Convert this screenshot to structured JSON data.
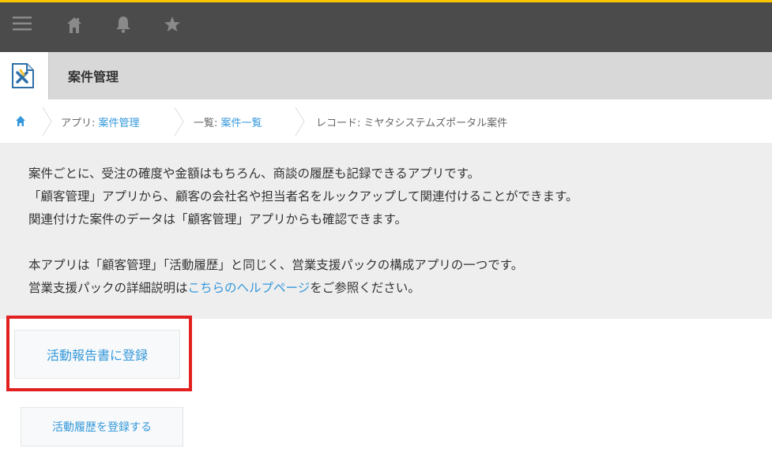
{
  "topbar": {
    "icons": [
      "menu-icon",
      "home-icon",
      "bell-icon",
      "star-icon"
    ]
  },
  "app_header": {
    "title": "案件管理",
    "icon": "app-icon"
  },
  "breadcrumb": {
    "home_icon": "home-icon",
    "app_prefix": "アプリ: ",
    "app_link": "案件管理",
    "list_prefix": "一覧: ",
    "list_link": "案件一覧",
    "record": "レコード: ミヤタシステムズポータル案件"
  },
  "description": {
    "line1": "案件ごとに、受注の確度や金額はもちろん、商談の履歴も記録できるアプリです。",
    "line2": "「顧客管理」アプリから、顧客の会社名や担当者名をルックアップして関連付けることができます。",
    "line3": "関連付けた案件のデータは「顧客管理」アプリからも確認できます。",
    "line4": "本アプリは「顧客管理」「活動履歴」と同じく、営業支援パックの構成アプリの一つです。",
    "line5_prefix": "営業支援パックの詳細説明は",
    "line5_link": "こちらのヘルプページ",
    "line5_suffix": "をご参照ください。"
  },
  "buttons": {
    "register_report": "活動報告書に登録",
    "register_history": "活動履歴を登録する"
  },
  "colors": {
    "topbar": "#4b4b4b",
    "accent": "#fdc600",
    "link": "#3498db",
    "highlight": "#e32020"
  }
}
